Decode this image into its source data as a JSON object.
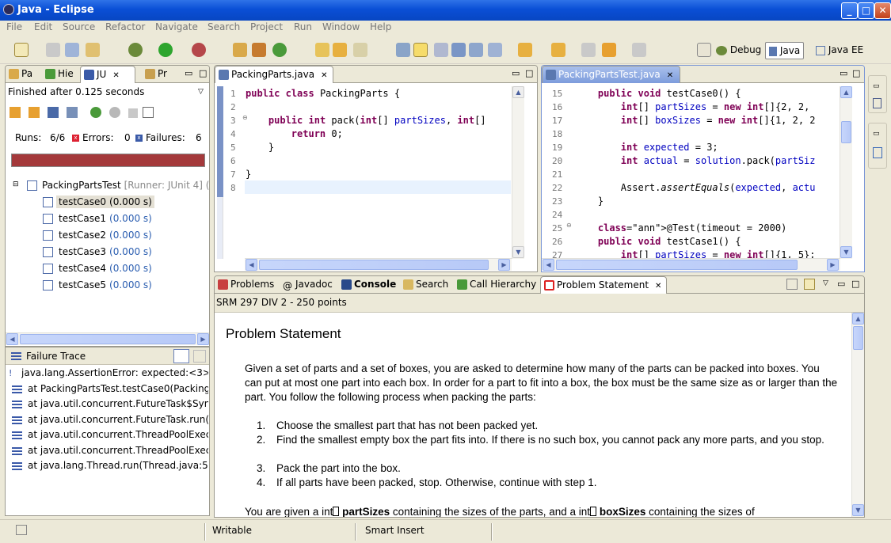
{
  "window": {
    "title": "Java - Eclipse"
  },
  "menu": [
    "File",
    "Edit",
    "Source",
    "Refactor",
    "Navigate",
    "Search",
    "Project",
    "Run",
    "Window",
    "Help"
  ],
  "perspectives": {
    "debug": "Debug",
    "java": "Java",
    "javaee": "Java EE"
  },
  "left_tabs": [
    "Pa",
    "Hie",
    "JU",
    "Pr"
  ],
  "junit": {
    "finished": "Finished after 0.125 seconds",
    "runs_label": "Runs:",
    "runs_value": "6/6",
    "errors_label": "Errors:",
    "errors_value": "0",
    "failures_label": "Failures:",
    "failures_value": "6",
    "bar_color": "#a4393b",
    "root": {
      "name": "PackingPartsTest",
      "runner": "[Runner: JUnit 4] ("
    },
    "cases": [
      {
        "name": "testCase0",
        "time": "(0.000 s)"
      },
      {
        "name": "testCase1",
        "time": "(0.000 s)"
      },
      {
        "name": "testCase2",
        "time": "(0.000 s)"
      },
      {
        "name": "testCase3",
        "time": "(0.000 s)"
      },
      {
        "name": "testCase4",
        "time": "(0.000 s)"
      },
      {
        "name": "testCase5",
        "time": "(0.000 s)"
      }
    ]
  },
  "failure_trace": {
    "title": "Failure Trace",
    "lines": [
      "java.lang.AssertionError: expected:<3>",
      "at PackingPartsTest.testCase0(Packing",
      "at java.util.concurrent.FutureTask$Syn",
      "at java.util.concurrent.FutureTask.run(",
      "at java.util.concurrent.ThreadPoolExecu",
      "at java.util.concurrent.ThreadPoolExecu",
      "at java.lang.Thread.run(Thread.java:59"
    ]
  },
  "editor1": {
    "tab": "PackingParts.java",
    "line_numbers": [
      "1",
      "2",
      "3",
      "4",
      "5",
      "6",
      "7",
      "8"
    ],
    "lines": [
      "public class PackingParts {",
      "",
      "    public int pack(int[] partSizes, int[]",
      "        return 0;",
      "    }",
      "",
      "}",
      ""
    ]
  },
  "editor2": {
    "tab": "PackingPartsTest.java",
    "line_numbers": [
      "15",
      "16",
      "17",
      "18",
      "19",
      "20",
      "21",
      "22",
      "23",
      "24",
      "25",
      "26",
      "27"
    ],
    "lines": [
      "    public void testCase0() {",
      "        int[] partSizes = new int[]{2, 2,",
      "        int[] boxSizes = new int[]{1, 2, 2",
      "",
      "        int expected = 3;",
      "        int actual = solution.pack(partSiz",
      "",
      "        Assert.assertEquals(expected, actu",
      "    }",
      "",
      "    @Test(timeout = 2000)",
      "    public void testCase1() {",
      "        int[] partSizes = new int[]{1, 5};"
    ]
  },
  "bottom_tabs": [
    "Problems",
    "Javadoc",
    "Console",
    "Search",
    "Call Hierarchy",
    "Problem Statement"
  ],
  "problem": {
    "header": "SRM 297 DIV 2 - 250 points",
    "title": "Problem Statement",
    "para1": "Given a set of parts and a set of boxes, you are asked to determine how many of the parts can be packed into boxes. You can put at most one part into each box. In order for a part to fit into a box, the box must be the same size as or larger than the part. You follow the following process when packing the parts:",
    "steps": [
      "Choose the smallest part that has not been packed yet.",
      "Find the smallest empty box the part fits into. If there is no such box, you cannot pack any more parts, and you stop.",
      "Pack the part into the box.",
      "If all parts have been packed, stop. Otherwise, continue with step 1."
    ],
    "para2_a": "You are given a int",
    "para2_b": "partSizes",
    "para2_c": " containing the sizes of the parts, and a int",
    "para2_d": "boxSizes",
    "para2_e": " containing the sizes of"
  },
  "status": {
    "writable": "Writable",
    "insert": "Smart Insert"
  }
}
